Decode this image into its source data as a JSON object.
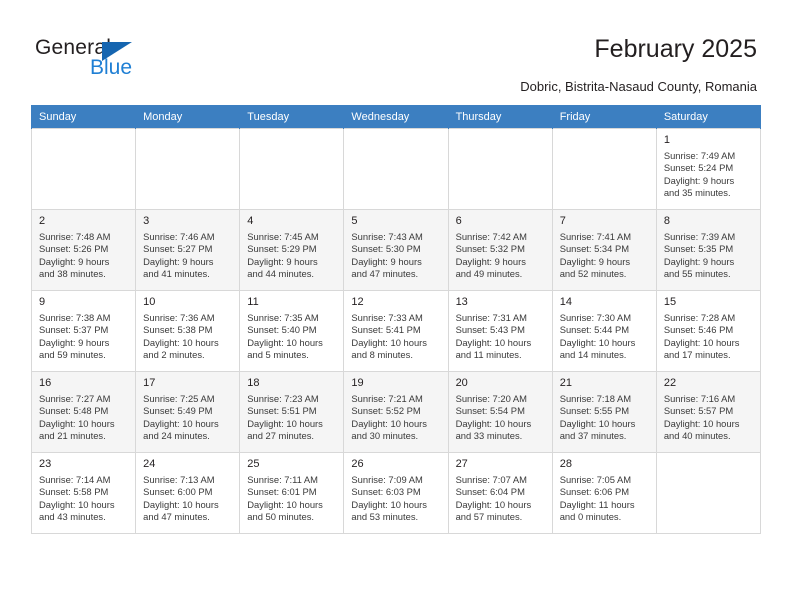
{
  "brand": {
    "name_part1": "General",
    "name_part2": "Blue",
    "accent_color": "#1f7fd4",
    "triangle_color": "#1565b0"
  },
  "header": {
    "title": "February 2025",
    "subtitle": "Dobric, Bistrita-Nasaud County, Romania"
  },
  "calendar": {
    "header_bg": "#3c7fc1",
    "weekdays": [
      "Sunday",
      "Monday",
      "Tuesday",
      "Wednesday",
      "Thursday",
      "Friday",
      "Saturday"
    ],
    "weeks": [
      [
        {
          "day": "",
          "info": "",
          "empty": true
        },
        {
          "day": "",
          "info": "",
          "empty": true
        },
        {
          "day": "",
          "info": "",
          "empty": true
        },
        {
          "day": "",
          "info": "",
          "empty": true
        },
        {
          "day": "",
          "info": "",
          "empty": true
        },
        {
          "day": "",
          "info": "",
          "empty": true
        },
        {
          "day": "1",
          "info": "Sunrise: 7:49 AM\nSunset: 5:24 PM\nDaylight: 9 hours\nand 35 minutes."
        }
      ],
      [
        {
          "day": "2",
          "info": "Sunrise: 7:48 AM\nSunset: 5:26 PM\nDaylight: 9 hours\nand 38 minutes."
        },
        {
          "day": "3",
          "info": "Sunrise: 7:46 AM\nSunset: 5:27 PM\nDaylight: 9 hours\nand 41 minutes."
        },
        {
          "day": "4",
          "info": "Sunrise: 7:45 AM\nSunset: 5:29 PM\nDaylight: 9 hours\nand 44 minutes."
        },
        {
          "day": "5",
          "info": "Sunrise: 7:43 AM\nSunset: 5:30 PM\nDaylight: 9 hours\nand 47 minutes."
        },
        {
          "day": "6",
          "info": "Sunrise: 7:42 AM\nSunset: 5:32 PM\nDaylight: 9 hours\nand 49 minutes."
        },
        {
          "day": "7",
          "info": "Sunrise: 7:41 AM\nSunset: 5:34 PM\nDaylight: 9 hours\nand 52 minutes."
        },
        {
          "day": "8",
          "info": "Sunrise: 7:39 AM\nSunset: 5:35 PM\nDaylight: 9 hours\nand 55 minutes."
        }
      ],
      [
        {
          "day": "9",
          "info": "Sunrise: 7:38 AM\nSunset: 5:37 PM\nDaylight: 9 hours\nand 59 minutes."
        },
        {
          "day": "10",
          "info": "Sunrise: 7:36 AM\nSunset: 5:38 PM\nDaylight: 10 hours\nand 2 minutes."
        },
        {
          "day": "11",
          "info": "Sunrise: 7:35 AM\nSunset: 5:40 PM\nDaylight: 10 hours\nand 5 minutes."
        },
        {
          "day": "12",
          "info": "Sunrise: 7:33 AM\nSunset: 5:41 PM\nDaylight: 10 hours\nand 8 minutes."
        },
        {
          "day": "13",
          "info": "Sunrise: 7:31 AM\nSunset: 5:43 PM\nDaylight: 10 hours\nand 11 minutes."
        },
        {
          "day": "14",
          "info": "Sunrise: 7:30 AM\nSunset: 5:44 PM\nDaylight: 10 hours\nand 14 minutes."
        },
        {
          "day": "15",
          "info": "Sunrise: 7:28 AM\nSunset: 5:46 PM\nDaylight: 10 hours\nand 17 minutes."
        }
      ],
      [
        {
          "day": "16",
          "info": "Sunrise: 7:27 AM\nSunset: 5:48 PM\nDaylight: 10 hours\nand 21 minutes."
        },
        {
          "day": "17",
          "info": "Sunrise: 7:25 AM\nSunset: 5:49 PM\nDaylight: 10 hours\nand 24 minutes."
        },
        {
          "day": "18",
          "info": "Sunrise: 7:23 AM\nSunset: 5:51 PM\nDaylight: 10 hours\nand 27 minutes."
        },
        {
          "day": "19",
          "info": "Sunrise: 7:21 AM\nSunset: 5:52 PM\nDaylight: 10 hours\nand 30 minutes."
        },
        {
          "day": "20",
          "info": "Sunrise: 7:20 AM\nSunset: 5:54 PM\nDaylight: 10 hours\nand 33 minutes."
        },
        {
          "day": "21",
          "info": "Sunrise: 7:18 AM\nSunset: 5:55 PM\nDaylight: 10 hours\nand 37 minutes."
        },
        {
          "day": "22",
          "info": "Sunrise: 7:16 AM\nSunset: 5:57 PM\nDaylight: 10 hours\nand 40 minutes."
        }
      ],
      [
        {
          "day": "23",
          "info": "Sunrise: 7:14 AM\nSunset: 5:58 PM\nDaylight: 10 hours\nand 43 minutes."
        },
        {
          "day": "24",
          "info": "Sunrise: 7:13 AM\nSunset: 6:00 PM\nDaylight: 10 hours\nand 47 minutes."
        },
        {
          "day": "25",
          "info": "Sunrise: 7:11 AM\nSunset: 6:01 PM\nDaylight: 10 hours\nand 50 minutes."
        },
        {
          "day": "26",
          "info": "Sunrise: 7:09 AM\nSunset: 6:03 PM\nDaylight: 10 hours\nand 53 minutes."
        },
        {
          "day": "27",
          "info": "Sunrise: 7:07 AM\nSunset: 6:04 PM\nDaylight: 10 hours\nand 57 minutes."
        },
        {
          "day": "28",
          "info": "Sunrise: 7:05 AM\nSunset: 6:06 PM\nDaylight: 11 hours\nand 0 minutes."
        },
        {
          "day": "",
          "info": "",
          "empty": true
        }
      ]
    ]
  }
}
